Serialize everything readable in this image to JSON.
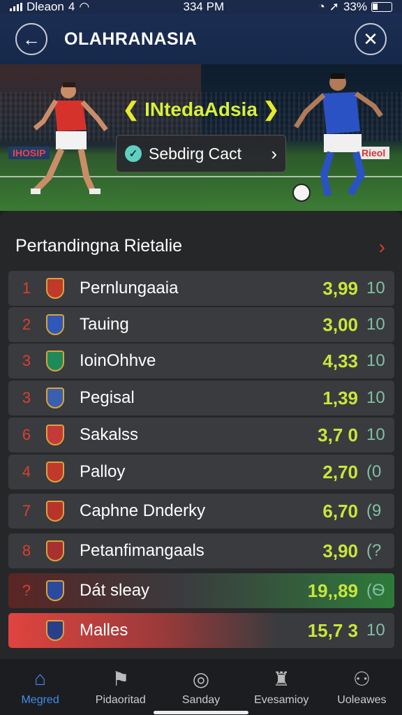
{
  "status": {
    "carrier": "Dleaon",
    "network": "4",
    "time": "334 PM",
    "battery": "33%"
  },
  "header": {
    "title": "OLAHRANASIA"
  },
  "hero": {
    "promo_text": "INtedaAdsia",
    "arrow_left": "❮",
    "arrow_right": "❯",
    "cta_label": "Sebdirg Cact",
    "board_left": "IHOSIP",
    "board_right": "Rieol"
  },
  "section": {
    "title": "Pertandingna Rietalie"
  },
  "rows": [
    {
      "rank": "1",
      "name": "Pernlungaaia",
      "score": "3,99",
      "pts": "10",
      "crest": "#c0392b"
    },
    {
      "rank": "2",
      "name": "Tauing",
      "score": "3,00",
      "pts": "10",
      "crest": "#2f58b8"
    },
    {
      "rank": "3",
      "name": "IoinOhhve",
      "score": "4,33",
      "pts": "10",
      "crest": "#1e8a5a"
    },
    {
      "rank": "3",
      "name": "Pegisal",
      "score": "1,39",
      "pts": "10",
      "crest": "#3a5fb0"
    },
    {
      "rank": "6",
      "name": "Sakalss",
      "score": "3,7 0",
      "pts": "10",
      "crest": "#c43a3a"
    },
    {
      "rank": "4",
      "name": "Palloy",
      "score": "2,70",
      "pts": "(0",
      "crest": "#c0392b"
    },
    {
      "rank": "7",
      "name": "Caphne Dnderky",
      "score": "6,70",
      "pts": "(9",
      "crest": "#b8342a"
    },
    {
      "rank": "8",
      "name": "Petanfimangaals",
      "score": "3,90",
      "pts": "(?",
      "crest": "#a83030"
    },
    {
      "rank": "?",
      "name": "Dát sleay",
      "score": "19,,89",
      "pts": "(Ѳ",
      "crest": "#2a4aa0"
    },
    {
      "rank": "?",
      "name": "Malles",
      "score": "15,7 3",
      "pts": "10",
      "crest": "#2a3f8a"
    }
  ],
  "nav": [
    {
      "label": "Megred",
      "icon": "home-icon",
      "glyph": "⌂"
    },
    {
      "label": "Pidaoritad",
      "icon": "flag-icon",
      "glyph": "⚑"
    },
    {
      "label": "Sanday",
      "icon": "ball-icon",
      "glyph": "◎"
    },
    {
      "label": "Evesamioy",
      "icon": "trophy-icon",
      "glyph": "♜"
    },
    {
      "label": "Uoleawes",
      "icon": "group-icon",
      "glyph": "⚇"
    }
  ],
  "colors": {
    "accent": "#3e8ef0",
    "score": "#c8e63a",
    "rank": "#d8402f",
    "appbar": "#1b2d52"
  }
}
